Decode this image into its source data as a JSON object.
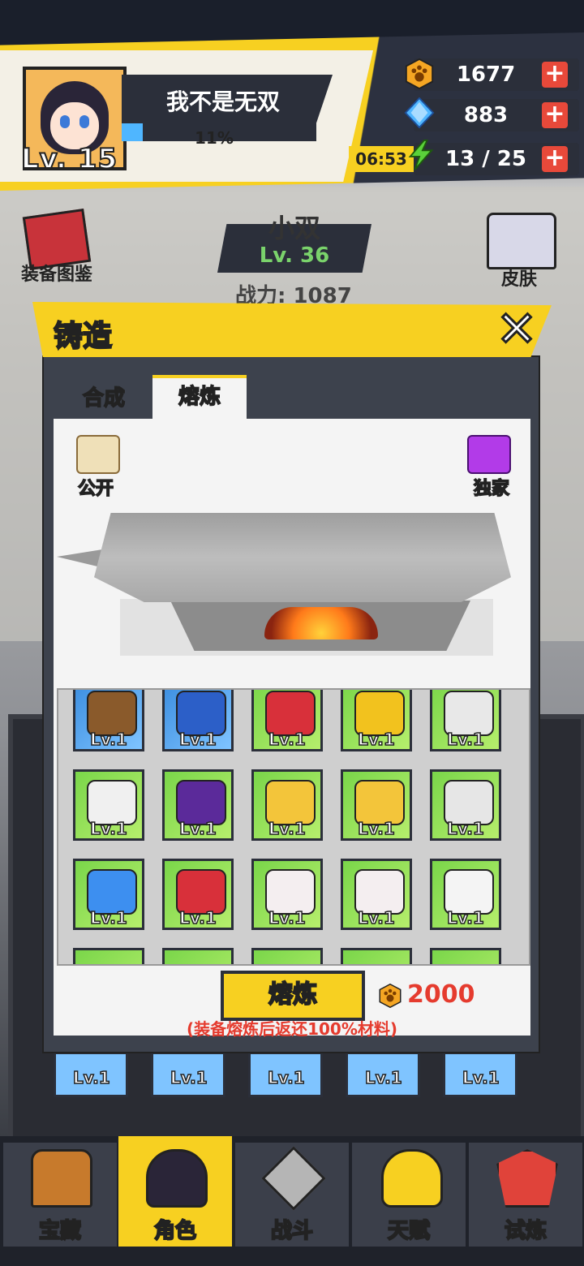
{
  "player": {
    "name": "我不是无双",
    "level_label": "Lv. 15",
    "xp_percent": 11,
    "xp_label": "11%"
  },
  "resources": {
    "gold": {
      "icon": "paw-coin-icon",
      "value": "1677"
    },
    "gem": {
      "icon": "diamond-icon",
      "value": "883"
    },
    "energy": {
      "icon": "lightning-icon",
      "value": "13 / 25",
      "timer": "06:53"
    }
  },
  "side": {
    "codex": "装备图鉴",
    "skin": "皮肤"
  },
  "character": {
    "name": "小双",
    "level": "Lv. 36",
    "power": "战力: 1087"
  },
  "modal": {
    "title": "铸造",
    "tabs": [
      "合成",
      "熔炼"
    ],
    "active_tab": "熔炼",
    "public_label": "公开",
    "exclusive_label": "独家",
    "items": [
      {
        "name": "boots-icon",
        "lv": "Lv.1",
        "bg": "blue"
      },
      {
        "name": "blue-boots-icon",
        "lv": "Lv.1",
        "bg": "blue"
      },
      {
        "name": "red-blade-icon",
        "lv": "Lv.1",
        "bg": "green"
      },
      {
        "name": "gold-blade-icon",
        "lv": "Lv.1",
        "bg": "green"
      },
      {
        "name": "silver-blade-icon",
        "lv": "Lv.1",
        "bg": "green"
      },
      {
        "name": "knife-icon",
        "lv": "Lv.1",
        "bg": "green"
      },
      {
        "name": "ring-icon",
        "lv": "Lv.1",
        "bg": "green"
      },
      {
        "name": "gold-amulet-icon",
        "lv": "Lv.1",
        "bg": "green"
      },
      {
        "name": "gold-amulet-icon",
        "lv": "Lv.1",
        "bg": "green"
      },
      {
        "name": "pearl-necklace-icon",
        "lv": "Lv.1",
        "bg": "green"
      },
      {
        "name": "blue-pendant-icon",
        "lv": "Lv.1",
        "bg": "green"
      },
      {
        "name": "red-scarf-icon",
        "lv": "Lv.1",
        "bg": "green"
      },
      {
        "name": "cap-icon",
        "lv": "Lv.1",
        "bg": "green"
      },
      {
        "name": "cap-icon",
        "lv": "Lv.1",
        "bg": "green"
      },
      {
        "name": "mask-icon",
        "lv": "Lv.1",
        "bg": "green"
      }
    ],
    "smelt_button": "熔炼",
    "cost": "2000",
    "notice": "(装备熔炼后返还100%材料)"
  },
  "background_lv": [
    "Lv.1",
    "Lv.1",
    "Lv.1",
    "Lv.1",
    "Lv.1"
  ],
  "nav": [
    {
      "label": "宝藏",
      "icon": "treasure-chest-icon"
    },
    {
      "label": "角色",
      "icon": "character-icon"
    },
    {
      "label": "战斗",
      "icon": "swords-icon"
    },
    {
      "label": "天赋",
      "icon": "lightbulb-icon"
    },
    {
      "label": "试炼",
      "icon": "crest-icon"
    }
  ],
  "colors": {
    "accent": "#f7d021",
    "dark": "#2b2f3a",
    "cost_red": "#e53b2e",
    "item_green": "#7ad64a",
    "item_blue": "#3c8ee0"
  }
}
